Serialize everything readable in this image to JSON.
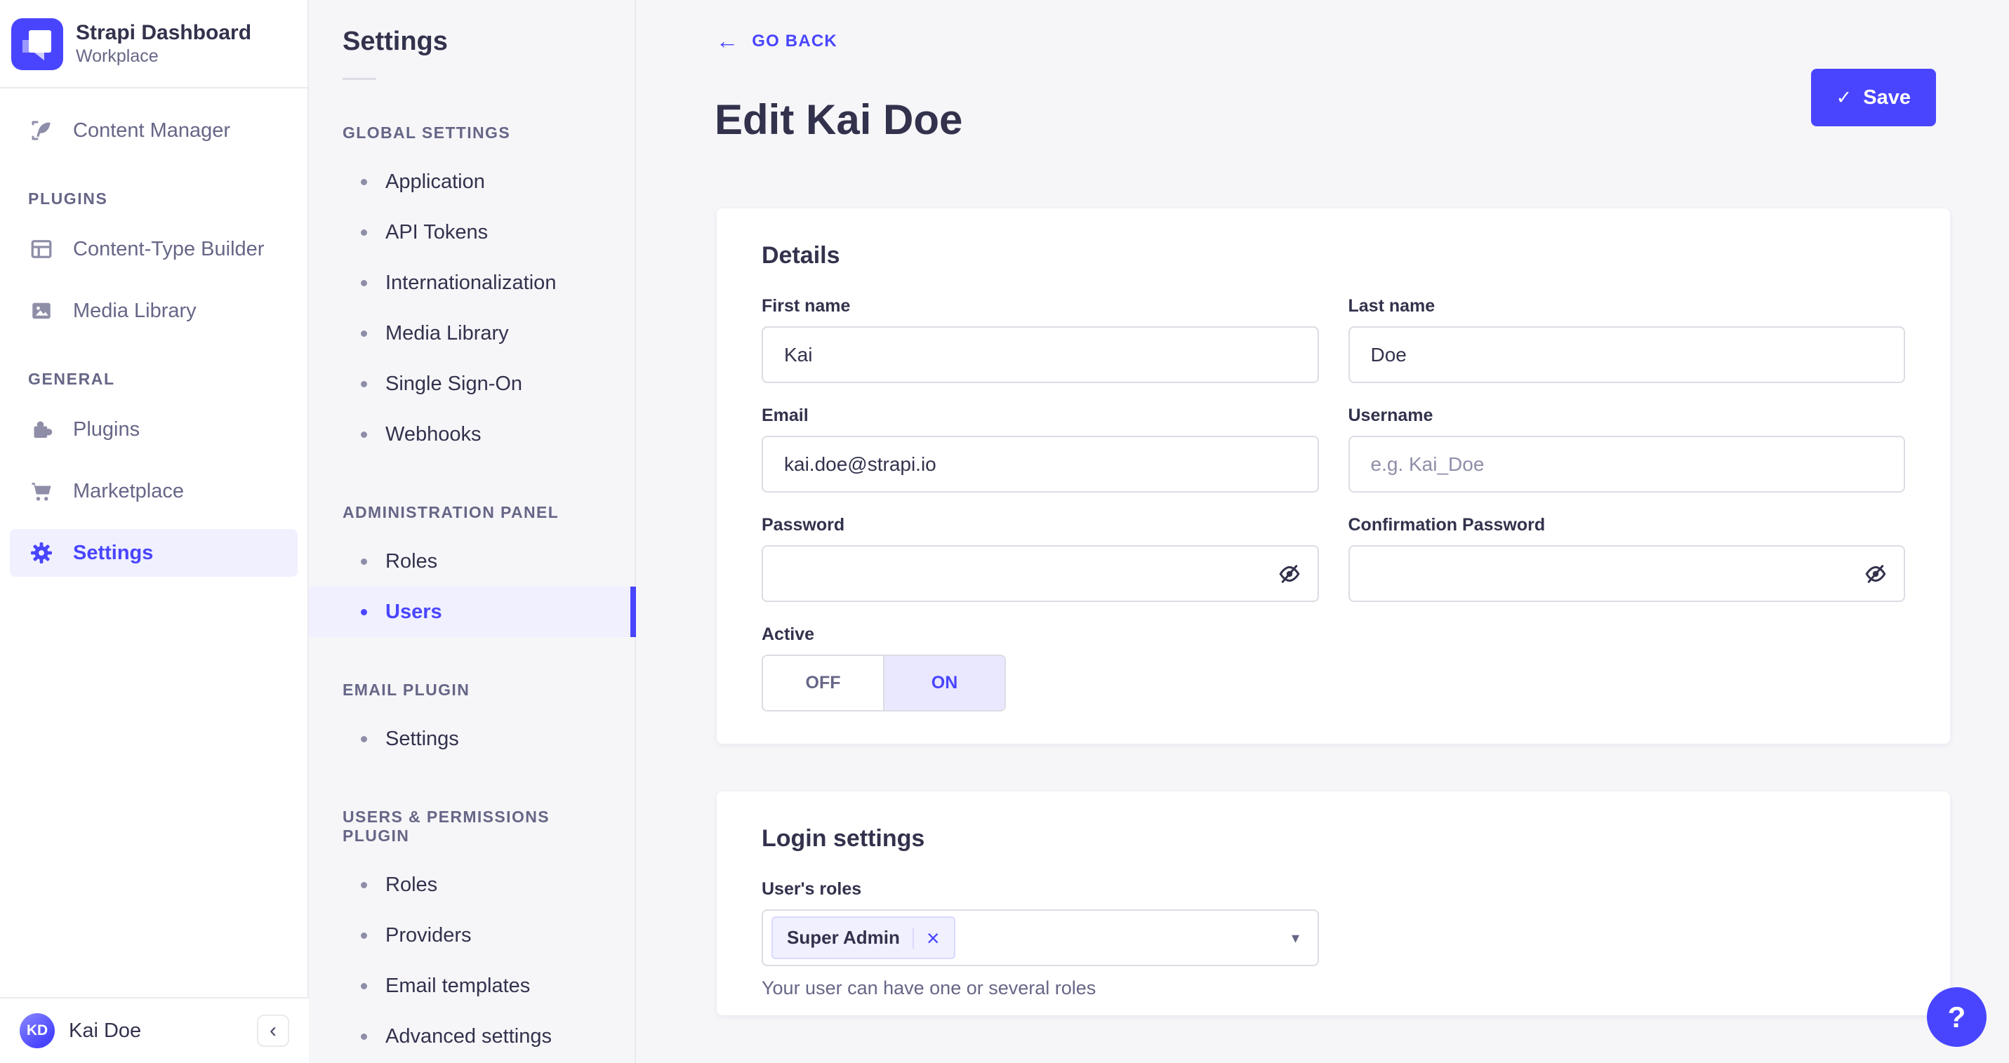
{
  "colors": {
    "primary": "#4945ff",
    "primary_light_bg": "#f0f0ff",
    "toggle_on_bg": "#e9e8ff",
    "tag_border": "#d9d8ff",
    "text_dark": "#32324d",
    "text_muted": "#666687",
    "placeholder": "#8e8ea9",
    "input_border": "#dcdce4",
    "divider": "#eaeaef",
    "page_bg": "#f6f6f9"
  },
  "icons": {
    "back_arrow": "←",
    "check": "✓",
    "close": "×",
    "caret_down": "▾",
    "collapse": "‹",
    "help": "?"
  },
  "sidebar": {
    "title": "Strapi Dashboard",
    "subtitle": "Workplace",
    "content_manager_label": "Content Manager",
    "plugins_heading": "PLUGINS",
    "content_type_builder_label": "Content-Type Builder",
    "media_library_label": "Media Library",
    "general_heading": "GENERAL",
    "plugins_label": "Plugins",
    "marketplace_label": "Marketplace",
    "settings_label": "Settings",
    "user": {
      "initials": "KD",
      "name": "Kai Doe"
    }
  },
  "settings_nav": {
    "title": "Settings",
    "global_heading": "GLOBAL SETTINGS",
    "global_items": [
      "Application",
      "API Tokens",
      "Internationalization",
      "Media Library",
      "Single Sign-On",
      "Webhooks"
    ],
    "admin_heading": "ADMINISTRATION PANEL",
    "admin_items": [
      "Roles",
      "Users"
    ],
    "active_item": "Users",
    "email_heading": "EMAIL PLUGIN",
    "email_items": [
      "Settings"
    ],
    "up_heading": "USERS & PERMISSIONS PLUGIN",
    "up_items": [
      "Roles",
      "Providers",
      "Email templates",
      "Advanced settings"
    ]
  },
  "header": {
    "go_back": "GO BACK",
    "title": "Edit Kai Doe",
    "save": "Save"
  },
  "details": {
    "title": "Details",
    "first_name": {
      "label": "First name",
      "value": "Kai"
    },
    "last_name": {
      "label": "Last name",
      "value": "Doe"
    },
    "email": {
      "label": "Email",
      "value": "kai.doe@strapi.io"
    },
    "username": {
      "label": "Username",
      "placeholder": "e.g. Kai_Doe"
    },
    "password": {
      "label": "Password"
    },
    "confirmation_password": {
      "label": "Confirmation Password"
    },
    "active": {
      "label": "Active",
      "off": "OFF",
      "on": "ON",
      "selected": "ON"
    }
  },
  "login": {
    "title": "Login settings",
    "roles_label": "User's roles",
    "selected_role": "Super Admin",
    "helper": "Your user can have one or several roles"
  }
}
